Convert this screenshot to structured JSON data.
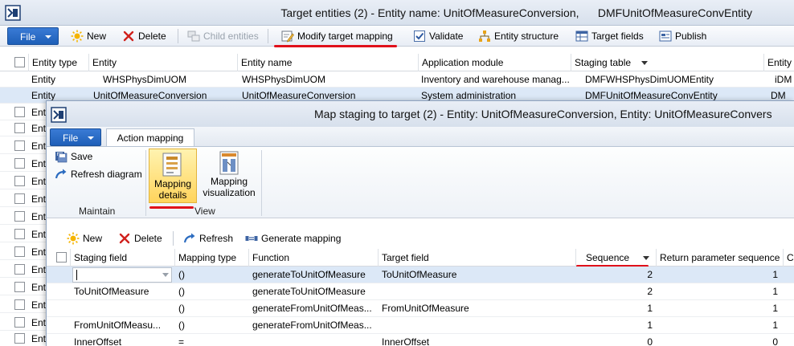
{
  "outer": {
    "title": "Target entities (2) - Entity name: UnitOfMeasureConversion,      DMFUnitOfMeasureConvEntity",
    "toolbar": {
      "file": "File",
      "new": "New",
      "delete": "Delete",
      "child_entities": "Child entities",
      "modify_target_mapping": "Modify target mapping",
      "validate": "Validate",
      "entity_structure": "Entity structure",
      "target_fields": "Target fields",
      "publish": "Publish"
    },
    "grid": {
      "columns": [
        "Entity type",
        "Entity",
        "Entity name",
        "Application module",
        "Staging table",
        "Entity"
      ],
      "rows": [
        [
          "Entity",
          "WHSPhysDimUOM",
          "WHSPhysDimUOM",
          "Inventory and warehouse manag...",
          "DMFWHSPhysDimUOMEntity",
          "iDM"
        ],
        [
          "Entity",
          "UnitOfMeasureConversion",
          "UnitOfMeasureConversion",
          "System administration",
          "DMFUnitOfMeasureConvEntity",
          "DM"
        ]
      ],
      "truncated_rows": [
        "Enti",
        "Enti",
        "Enti",
        "Enti",
        "Enti",
        "Enti",
        "Enti",
        "Enti",
        "Enti",
        "Enti",
        "Enti",
        "Enti",
        "Enti",
        "Enti",
        "Enti"
      ]
    }
  },
  "inner": {
    "title": "Map staging to target (2) - Entity: UnitOfMeasureConversion, Entity: UnitOfMeasureConvers",
    "tabs": {
      "file": "File",
      "action_mapping": "Action mapping"
    },
    "ribbon": {
      "save": "Save",
      "refresh_diagram": "Refresh diagram",
      "maintain_group": "Maintain",
      "mapping_details_1": "Mapping",
      "mapping_details_2": "details",
      "mapping_viz_1": "Mapping",
      "mapping_viz_2": "visualization",
      "view_group": "View"
    },
    "toolbar": {
      "new": "New",
      "delete": "Delete",
      "refresh": "Refresh",
      "generate_mapping": "Generate mapping"
    },
    "grid": {
      "columns": [
        "Staging field",
        "Mapping type",
        "Function",
        "Target field",
        "Sequence",
        "Return parameter sequence",
        "C"
      ],
      "rows": [
        [
          "",
          "()",
          "generateToUnitOfMeasure",
          "ToUnitOfMeasure",
          "2",
          "1"
        ],
        [
          "ToUnitOfMeasure",
          "()",
          "generateToUnitOfMeasure",
          "",
          "2",
          "1"
        ],
        [
          "",
          "()",
          "generateFromUnitOfMeas...",
          "FromUnitOfMeasure",
          "1",
          "1"
        ],
        [
          "FromUnitOfMeasu...",
          "()",
          "generateFromUnitOfMeas...",
          "",
          "1",
          "1"
        ],
        [
          "InnerOffset",
          "=",
          "",
          "InnerOffset",
          "0",
          "0"
        ]
      ]
    }
  },
  "colors": {
    "file_button": "#1e5fb8",
    "highlight_red": "#e0101a",
    "selected_row": "#dce8f7",
    "active_button": "#ffd45c"
  }
}
